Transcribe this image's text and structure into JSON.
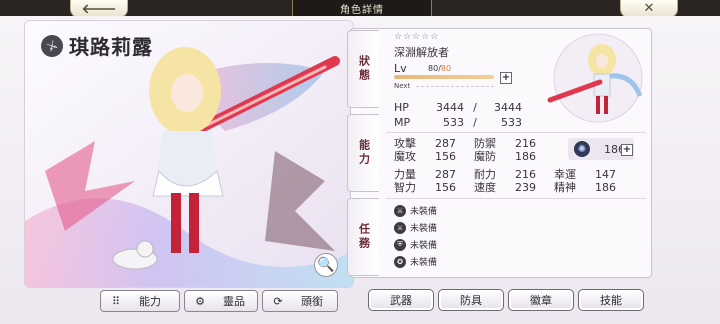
{
  "header": {
    "title": "角色詳情",
    "back_icon": "arrow-left-icon",
    "close_icon": "close-icon",
    "back_glyph": "🡐",
    "close_glyph": "✕"
  },
  "character": {
    "name": "琪路莉露",
    "stars": "☆☆☆☆☆",
    "job": "深淵解放者",
    "lv_label": "Lv",
    "lv_current": "80",
    "lv_sep": "/",
    "lv_max": "80",
    "lv_progress": 1.0,
    "next_label": "Next",
    "hp_label": "HP",
    "hp_current": "3444",
    "hp_max": "3444",
    "mp_label": "MP",
    "mp_current": "533",
    "mp_max": "533",
    "slash": "/"
  },
  "stats": {
    "row1": [
      {
        "k": "攻擊",
        "v": "287"
      },
      {
        "k": "防禦",
        "v": "216"
      }
    ],
    "row2": [
      {
        "k": "魔攻",
        "v": "156"
      },
      {
        "k": "魔防",
        "v": "186"
      }
    ],
    "row3": [
      {
        "k": "力量",
        "v": "287"
      },
      {
        "k": "耐力",
        "v": "216"
      },
      {
        "k": "幸運",
        "v": "147"
      }
    ],
    "row4": [
      {
        "k": "智力",
        "v": "156"
      },
      {
        "k": "速度",
        "v": "239"
      },
      {
        "k": "精神",
        "v": "186"
      }
    ]
  },
  "rune": {
    "value": "186",
    "icon": "spiral-rune-icon"
  },
  "side_tabs": {
    "status": "狀態",
    "ability": "能力",
    "quest": "任務"
  },
  "equipment": [
    {
      "label": "未裝備",
      "icon": "sword-slot-icon"
    },
    {
      "label": "未裝備",
      "icon": "sword-slot-icon"
    },
    {
      "label": "未裝備",
      "icon": "armor-slot-icon"
    },
    {
      "label": "未裝備",
      "icon": "badge-slot-icon"
    }
  ],
  "left_buttons": {
    "ability": "能力",
    "spirit": "靈品",
    "title": "頭銜"
  },
  "right_buttons": {
    "weapon": "武器",
    "armor": "防具",
    "badge": "徽章",
    "skill": "技能"
  },
  "colors": {
    "accent": "#6b2f3c",
    "lv_max": "#d37a3a",
    "stars": "#6d7fb4"
  }
}
